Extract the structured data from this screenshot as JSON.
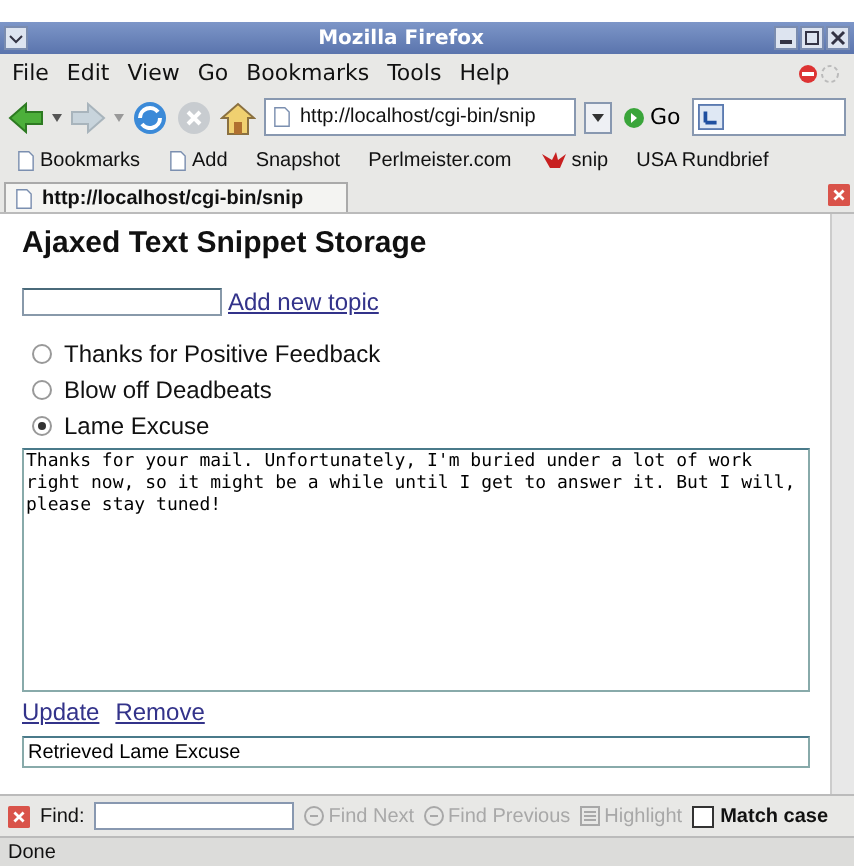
{
  "window": {
    "title": "Mozilla Firefox"
  },
  "menu": [
    {
      "label": "File"
    },
    {
      "label": "Edit"
    },
    {
      "label": "View"
    },
    {
      "label": "Go"
    },
    {
      "label": "Bookmarks"
    },
    {
      "label": "Tools"
    },
    {
      "label": "Help"
    }
  ],
  "toolbar": {
    "url": "http://localhost/cgi-bin/snip",
    "go": "Go"
  },
  "bookmarks": [
    {
      "label": "Bookmarks",
      "kind": "page"
    },
    {
      "label": "Add",
      "kind": "page"
    },
    {
      "label": "Snapshot",
      "kind": "plain"
    },
    {
      "label": "Perlmeister.com",
      "kind": "plain"
    },
    {
      "label": "snip",
      "kind": "logo"
    },
    {
      "label": "USA Rundbrief",
      "kind": "plain"
    }
  ],
  "tabs": [
    {
      "label": "http://localhost/cgi-bin/snip",
      "selected": true
    }
  ],
  "page": {
    "heading": "Ajaxed Text Snippet Storage",
    "add_link": "Add new topic",
    "topics": [
      {
        "label": "Thanks for Positive Feedback",
        "selected": false
      },
      {
        "label": "Blow off Deadbeats",
        "selected": false
      },
      {
        "label": "Lame Excuse",
        "selected": true
      }
    ],
    "snippet": "Thanks for your mail. Unfortunately, I'm buried under a lot of work right now, so it might be a while until I get to answer it. But I will, please stay tuned!",
    "links": [
      "Update",
      "Remove"
    ],
    "status_field": "Retrieved Lame Excuse"
  },
  "find_bar": {
    "label": "Find:",
    "buttons": [
      {
        "label": "Find Next",
        "disabled": true
      },
      {
        "label": "Find Previous",
        "disabled": true
      },
      {
        "label": "Highlight",
        "disabled": true
      }
    ],
    "match_case": {
      "label": "Match case",
      "checked": false
    }
  },
  "status_bar": "Done"
}
